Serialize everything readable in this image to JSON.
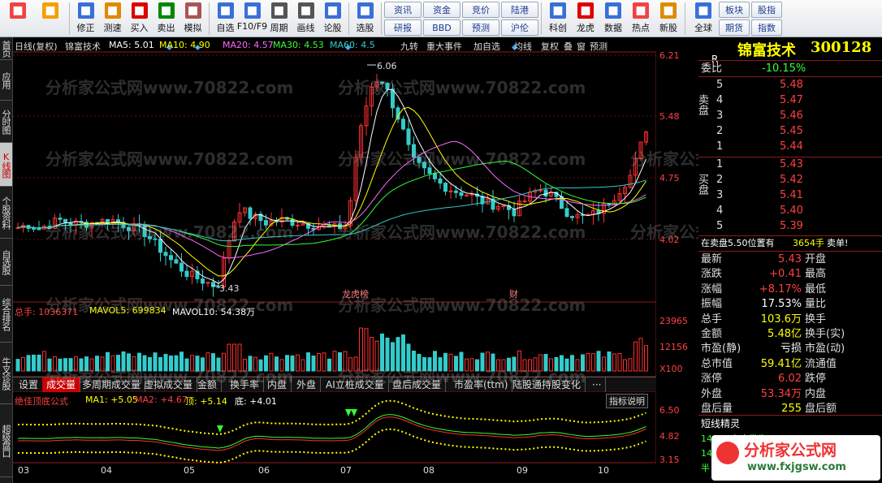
{
  "toolbar": {
    "items": [
      {
        "name": "layout-icon",
        "label": "",
        "color": "#e44"
      },
      {
        "name": "back-icon",
        "label": "",
        "color": "#f5a000"
      },
      {
        "name": "modify-icon",
        "label": "修正",
        "color": "#3a6fd8"
      },
      {
        "name": "clock-icon",
        "label": "测速",
        "color": "#e08a00"
      },
      {
        "name": "buy-icon",
        "label": "买入",
        "color": "#d00"
      },
      {
        "name": "sell-icon",
        "label": "卖出",
        "color": "#080"
      },
      {
        "name": "hammer-icon",
        "label": "模拟",
        "color": "#a55"
      },
      {
        "name": "watchlist-icon",
        "label": "自选",
        "color": "#3a6fd8"
      },
      {
        "name": "f10-icon",
        "label": "F10/F9",
        "color": "#3a6fd8"
      },
      {
        "name": "cycle-icon",
        "label": "周期",
        "color": "#555"
      },
      {
        "name": "pen-icon",
        "label": "画线",
        "color": "#555"
      },
      {
        "name": "forum-icon",
        "label": "论股",
        "color": "#3a6fd8"
      },
      {
        "name": "stock-pick-icon",
        "label": "选股",
        "color": "#3a6fd8"
      }
    ],
    "grid_a": [
      "资讯",
      "资金",
      "竞价",
      "陆港",
      "研报",
      "BBD",
      "预测",
      "沪伦"
    ],
    "items_b": [
      {
        "name": "kechuang-icon",
        "label": "科创",
        "color": "#3a6fd8"
      },
      {
        "name": "dragon-icon",
        "label": "龙虎",
        "color": "#d00"
      },
      {
        "name": "data-icon",
        "label": "数据",
        "color": "#3a6fd8"
      },
      {
        "name": "hot-icon",
        "label": "热点",
        "color": "#e44"
      },
      {
        "name": "newshare-icon",
        "label": "新股",
        "color": "#e08a00"
      },
      {
        "name": "globe-icon",
        "label": "全球",
        "color": "#3a6fd8"
      }
    ],
    "grid_b": [
      "板块",
      "股指",
      "期货",
      "指数"
    ]
  },
  "left_nav": [
    "首页",
    "应用",
    "分时图",
    "K线图",
    "个股资料",
    "自选股",
    "综合排名",
    "牛叉诊股",
    "超级盘口"
  ],
  "header": {
    "title": "日线(复权)",
    "stock": "锦富技术",
    "ma": [
      {
        "label": "MA5: 5.01",
        "color": "#ffffff"
      },
      {
        "label": "MA10: 4.90",
        "color": "#ffff00"
      },
      {
        "label": "MA20: 4.57",
        "color": "#ff66ff"
      },
      {
        "label": "MA30: 4.53",
        "color": "#33ff33"
      },
      {
        "label": "MA60: 4.5",
        "color": "#33cccc"
      }
    ],
    "tools": [
      "九转",
      "重大事件",
      "加自选",
      "均线",
      "复权",
      "叠",
      "窗",
      "预测"
    ]
  },
  "price_axis": [
    "6.21",
    "5.48",
    "4.75",
    "4.02"
  ],
  "annotations": {
    "high": "6.06",
    "low": "3.43",
    "tag1": "龙虎榜",
    "tag2": "财"
  },
  "volume": {
    "label": "总手: 1036371",
    "mavol5": "MAVOL5: 699834",
    "mavol10": "MAVOL10: 54.38万",
    "axis": [
      "23965",
      "12156",
      "X100"
    ]
  },
  "vol_tabs": [
    "设置",
    "成交量",
    "多周期成交量",
    "虚拟成交量",
    "金额",
    "换手率",
    "内盘",
    "外盘",
    "AI立桩成交量",
    "盘后成交量",
    "市盈率(ttm)",
    "陆股通持股变化",
    "···"
  ],
  "indicator": {
    "name": "绝佳顶底公式",
    "ma1": "MA1: +5.05",
    "ma2": "MA2: +4.67",
    "top": "顶: +5.14",
    "bottom": "底: +4.01",
    "button": "指标说明",
    "axis": [
      "6.50",
      "4.82",
      "3.15"
    ]
  },
  "x_axis": [
    "03",
    "04",
    "05",
    "06",
    "07",
    "08",
    "09",
    "10"
  ],
  "watermark": "分析家公式网www.70822.com",
  "right": {
    "stock_name": "锦富技术",
    "stock_code": "300128",
    "r_label": "R",
    "wei_bi": "委比",
    "wei_bi_val": "-10.15%",
    "sell_label": "卖盘",
    "buy_label": "买盘",
    "sell": [
      {
        "level": "5",
        "price": "5.48"
      },
      {
        "level": "4",
        "price": "5.47"
      },
      {
        "level": "3",
        "price": "5.46"
      },
      {
        "level": "2",
        "price": "5.45"
      },
      {
        "level": "1",
        "price": "5.44"
      }
    ],
    "buy": [
      {
        "level": "1",
        "price": "5.43"
      },
      {
        "level": "2",
        "price": "5.42"
      },
      {
        "level": "3",
        "price": "5.41"
      },
      {
        "level": "4",
        "price": "5.40"
      },
      {
        "level": "5",
        "price": "5.39"
      }
    ],
    "trade_notice": "在卖盘5.50位置有",
    "trade_qty": "3654手",
    "trade_dir": "卖单!",
    "quotes": [
      {
        "l": "最新",
        "v": "5.43",
        "vc": "#ff4040",
        "l2": "开盘"
      },
      {
        "l": "涨跌",
        "v": "+0.41",
        "vc": "#ff4040",
        "l2": "最高"
      },
      {
        "l": "涨幅",
        "v": "+8.17%",
        "vc": "#ff4040",
        "l2": "最低"
      },
      {
        "l": "振幅",
        "v": "17.53%",
        "vc": "#ffffff",
        "l2": "量比"
      },
      {
        "l": "总手",
        "v": "103.6万",
        "vc": "#ffff00",
        "l2": "换手"
      },
      {
        "l": "金额",
        "v": "5.48亿",
        "vc": "#ffff00",
        "l2": "换手(实)"
      },
      {
        "l": "市盈(静)",
        "v": "亏损",
        "vc": "#ffffff",
        "l2": "市盈(动)"
      },
      {
        "l": "总市值",
        "v": "59.41亿",
        "vc": "#ffff00",
        "l2": "流通值"
      },
      {
        "l": "涨停",
        "v": "6.02",
        "vc": "#ff4040",
        "l2": "跌停"
      },
      {
        "l": "外盘",
        "v": "53.34万",
        "vc": "#ff4040",
        "l2": "内盘"
      },
      {
        "l": "盘后量",
        "v": "255",
        "vc": "#ffff00",
        "l2": "盘后额"
      }
    ],
    "short_term": "短线精灵",
    "feed": [
      {
        "t": "14",
        "c": "东方发生"
      },
      {
        "t": "14",
        "c": "有事"
      },
      {
        "t": "半",
        "c": ""
      }
    ],
    "corner_logo": "分析家公式网",
    "corner_url": "www.fxjgsw.com"
  }
}
